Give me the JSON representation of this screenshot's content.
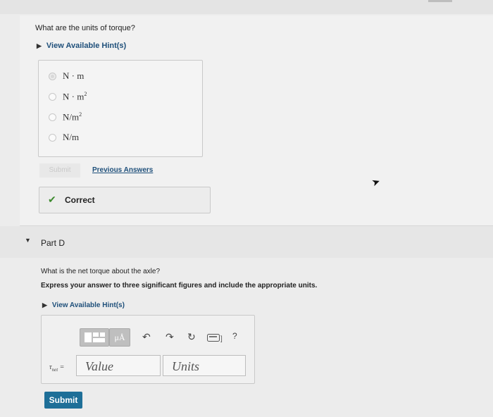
{
  "part_c": {
    "question": "What are the units of torque?",
    "hint_label": "View Available Hint(s)",
    "choices": [
      {
        "pre": "N · m",
        "sup": "",
        "post": "",
        "selected": true
      },
      {
        "pre": "N · m",
        "sup": "2",
        "post": "",
        "selected": false
      },
      {
        "pre": "N/m",
        "sup": "2",
        "post": "",
        "selected": false
      },
      {
        "pre": "N/m",
        "sup": "",
        "post": "",
        "selected": false
      }
    ],
    "submit_label": "Submit",
    "previous_answers_label": "Previous Answers",
    "result_label": "Correct"
  },
  "part_d": {
    "title": "Part D",
    "question": "What is the net torque about the axle?",
    "instruction": "Express your answer to three significant figures and include the appropriate units.",
    "hint_label": "View Available Hint(s)",
    "toolbar": {
      "units_button": "μÅ",
      "help": "?"
    },
    "variable_sub": "net",
    "equals": "=",
    "value_placeholder": "Value",
    "units_placeholder": "Units",
    "submit_label": "Submit"
  },
  "icons": {
    "undo": "undo-icon",
    "redo": "redo-icon",
    "reset": "reset-icon",
    "keyboard": "keyboard-icon"
  },
  "colors": {
    "link": "#1e4f7a",
    "submit": "#1e6f98",
    "correct": "#3c8a2e"
  }
}
